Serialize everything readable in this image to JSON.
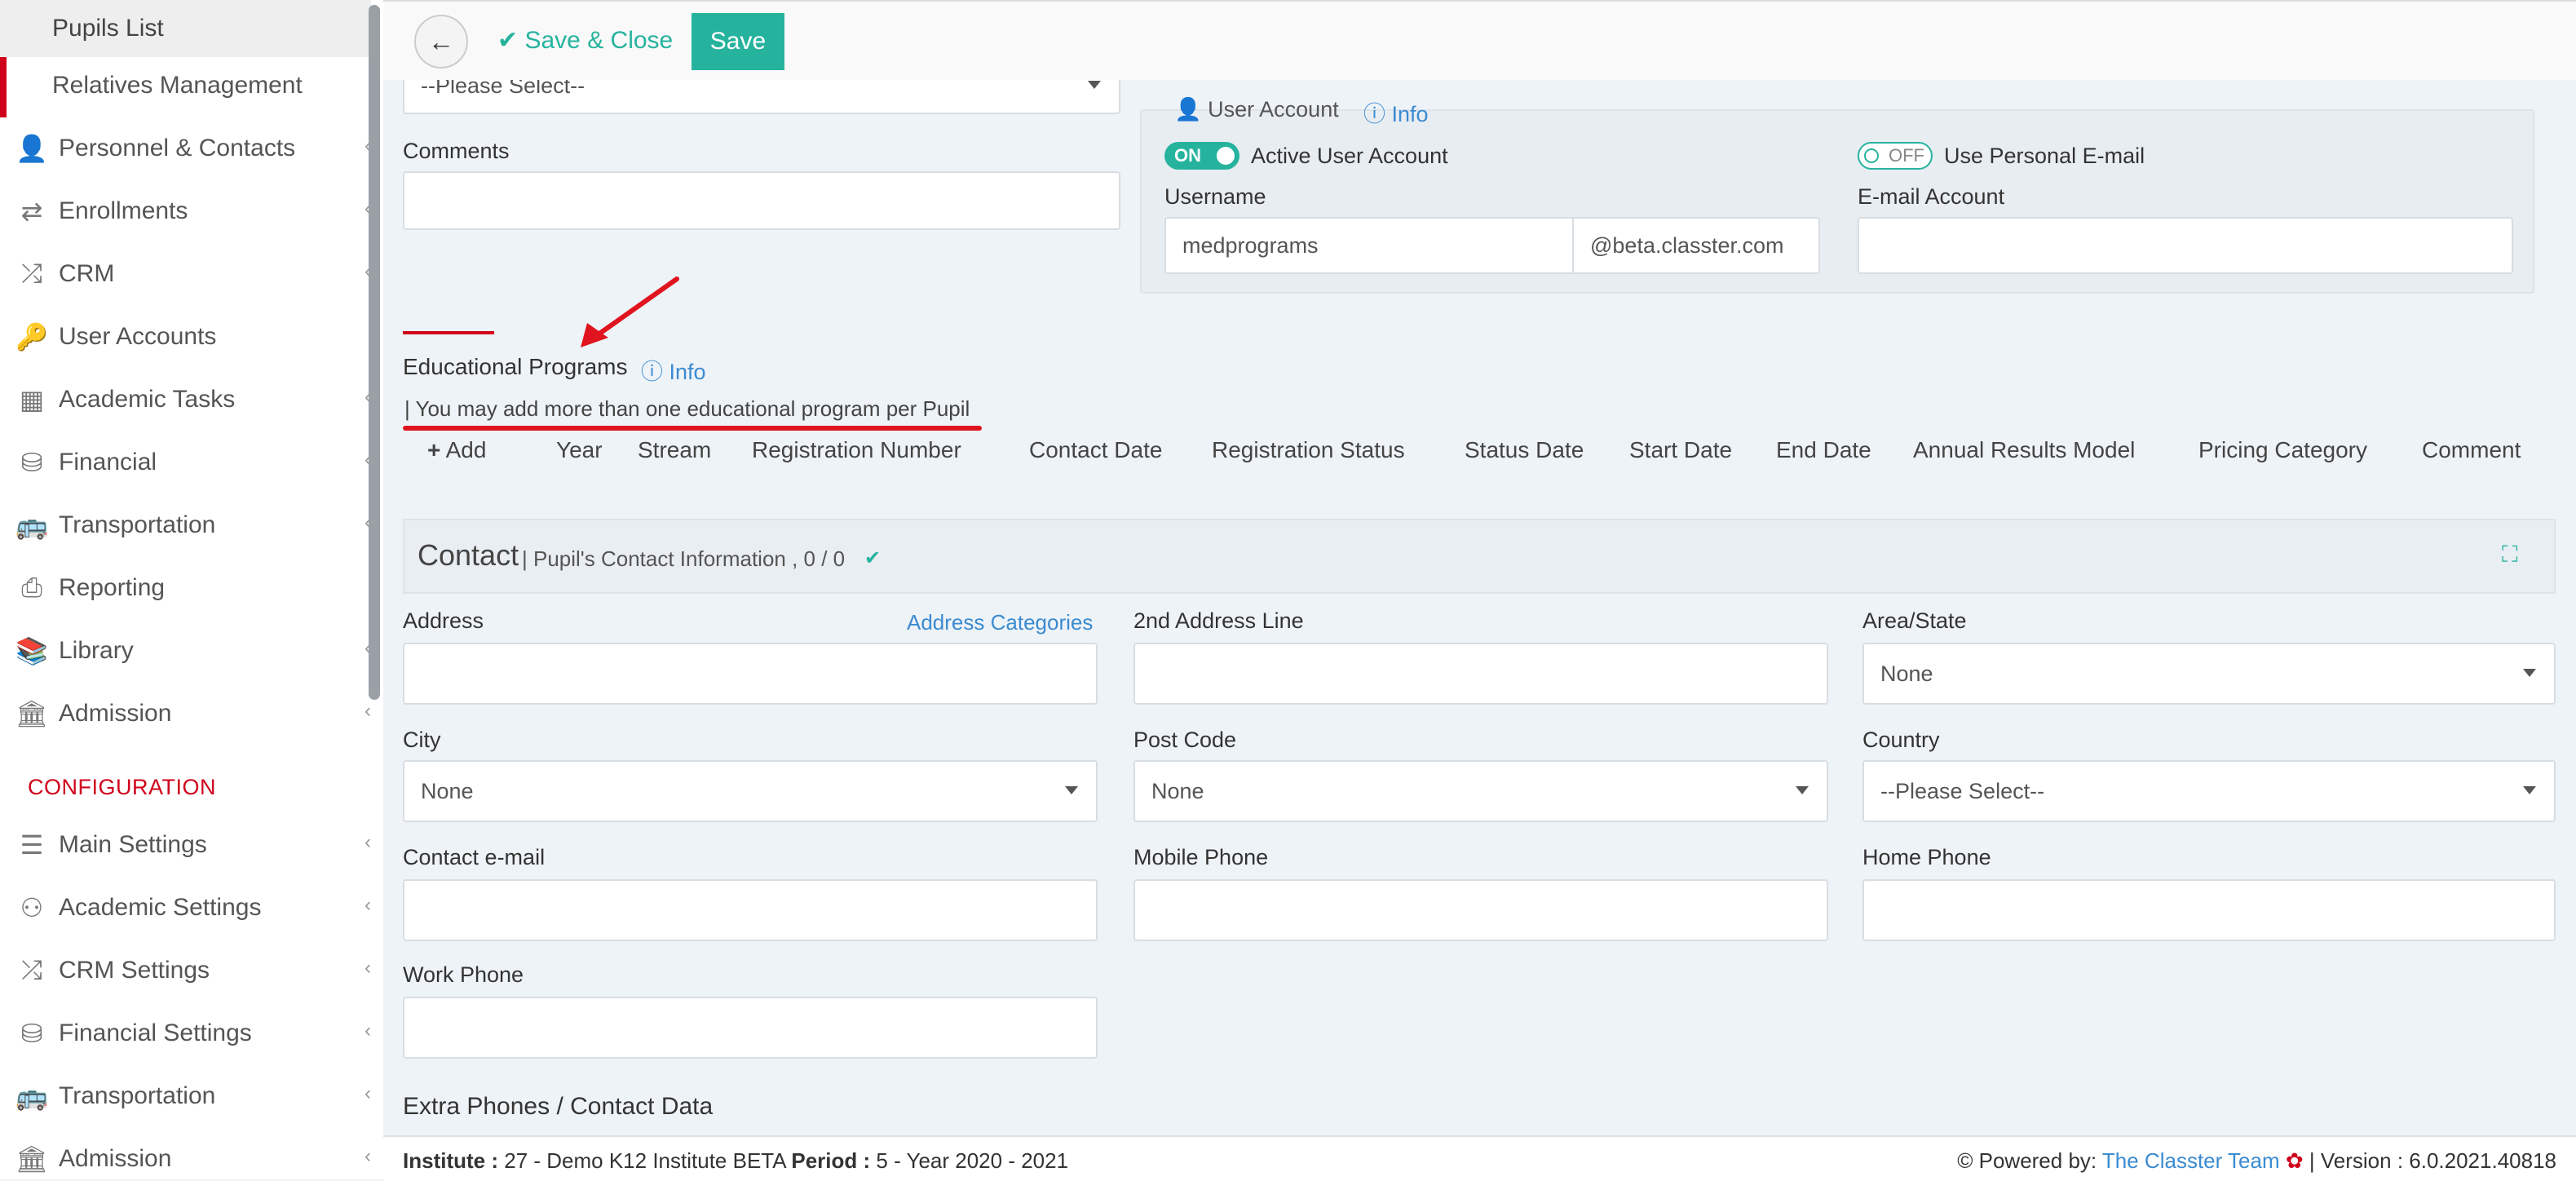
{
  "sidebar": {
    "sub_items": [
      "Pupils List",
      "Relatives Management"
    ],
    "items": [
      {
        "label": "Personnel & Contacts",
        "icon": "person-icon"
      },
      {
        "label": "Enrollments",
        "icon": "arrows-icon"
      },
      {
        "label": "CRM",
        "icon": "shuffle-icon"
      },
      {
        "label": "User Accounts",
        "icon": "key-icon"
      },
      {
        "label": "Academic Tasks",
        "icon": "grid-icon"
      },
      {
        "label": "Financial",
        "icon": "coins-icon"
      },
      {
        "label": "Transportation",
        "icon": "bus-icon"
      },
      {
        "label": "Reporting",
        "icon": "printer-icon"
      },
      {
        "label": "Library",
        "icon": "books-icon"
      },
      {
        "label": "Admission",
        "icon": "institution-icon"
      }
    ],
    "config_heading": "CONFIGURATION",
    "config_items": [
      {
        "label": "Main Settings",
        "icon": "sliders-icon"
      },
      {
        "label": "Academic Settings",
        "icon": "group-icon"
      },
      {
        "label": "CRM Settings",
        "icon": "shuffle-icon"
      },
      {
        "label": "Financial Settings",
        "icon": "coins-icon"
      },
      {
        "label": "Transportation",
        "icon": "bus-icon"
      },
      {
        "label": "Admission",
        "icon": "institution-icon"
      }
    ]
  },
  "toolbar": {
    "save_close_label": "Save & Close",
    "save_label": "Save"
  },
  "form": {
    "top_select_value": "--Please Select--",
    "comments_label": "Comments",
    "user_account": {
      "title": "User Account",
      "info_label": "Info",
      "active_toggle": "ON",
      "active_label": "Active User Account",
      "personal_toggle": "OFF",
      "personal_label": "Use Personal E-mail",
      "username_label": "Username",
      "username_value": "medprograms",
      "domain": "@beta.classter.com",
      "email_label": "E-mail Account"
    },
    "edu_programs": {
      "title": "Educational Programs",
      "info_label": "Info",
      "note": "| You may add more than one educational program per Pupil",
      "add_label": "Add",
      "columns": [
        "Year",
        "Stream",
        "Registration Number",
        "Contact Date",
        "Registration Status",
        "Status Date",
        "Start Date",
        "End Date",
        "Annual Results Model",
        "Pricing Category",
        "Comment"
      ]
    },
    "contact": {
      "title": "Contact",
      "subtitle": "| Pupil's Contact Information , 0 / 0",
      "address_label": "Address",
      "address_categories_link": "Address Categories",
      "address2_label": "2nd Address Line",
      "area_label": "Area/State",
      "area_value": "None",
      "city_label": "City",
      "city_value": "None",
      "postcode_label": "Post Code",
      "postcode_value": "None",
      "country_label": "Country",
      "country_value": "--Please Select--",
      "email_label": "Contact e-mail",
      "mobile_label": "Mobile Phone",
      "home_label": "Home Phone",
      "work_label": "Work Phone",
      "extra_label": "Extra Phones / Contact Data"
    }
  },
  "footer": {
    "institute_label": "Institute :",
    "institute_value": "27 - Demo K12 Institute BETA",
    "period_label": "Period :",
    "period_value": "5 - Year 2020 - 2021",
    "powered_by": "Powered by:",
    "team_link": "The Classter Team",
    "version": "| Version : 6.0.2021.40818"
  },
  "colors": {
    "accent": "#26b39e",
    "annotation_red": "#e0141e",
    "link": "#3b8bd0"
  }
}
